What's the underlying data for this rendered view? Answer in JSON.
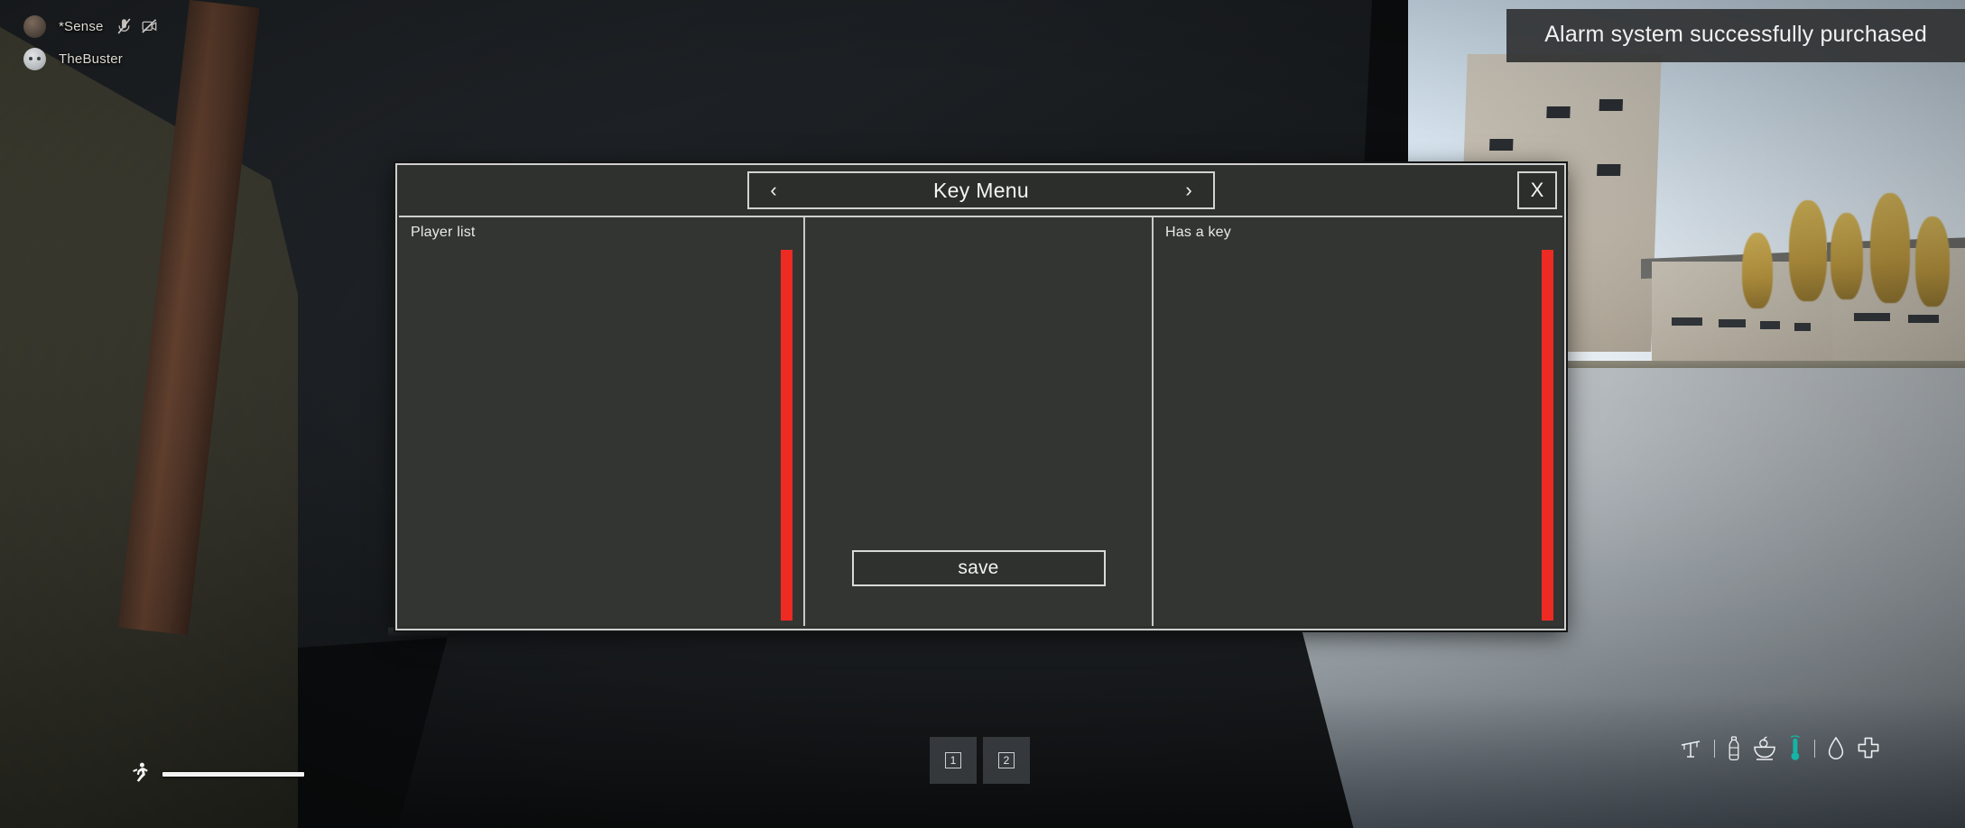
{
  "notification": {
    "icon": "none",
    "message": "Alarm system successfully purchased"
  },
  "player_hud": {
    "players": [
      {
        "name": "*Sense",
        "avatar": "player-avatar-dark",
        "status_icons": [
          "mic-muted-icon",
          "camera-muted-icon"
        ]
      },
      {
        "name": "TheBuster",
        "avatar": "player-avatar-light",
        "status_icons": []
      }
    ]
  },
  "key_menu": {
    "title": "Key Menu",
    "prev_label": "‹",
    "next_label": "›",
    "close_label": "X",
    "panels": {
      "left": {
        "title": "Player list",
        "items": [],
        "scrollbar_color": "#ee2b22"
      },
      "center": {
        "save_label": "save"
      },
      "right": {
        "title": "Has a key",
        "items": [],
        "scrollbar_color": "#ee2b22"
      }
    }
  },
  "bottom_hud": {
    "stamina": {
      "icon": "running-man-icon",
      "value": 100
    },
    "hotbar": [
      {
        "key": "1",
        "item": ""
      },
      {
        "key": "2",
        "item": ""
      }
    ],
    "status_icons": [
      {
        "name": "weight-icon",
        "state": "normal",
        "color": "#edf0f2"
      },
      {
        "name": "divider",
        "state": "static",
        "color": "#edf0f2"
      },
      {
        "name": "water-bottle-icon",
        "state": "normal",
        "color": "#edf0f2"
      },
      {
        "name": "food-bowl-icon",
        "state": "normal",
        "color": "#edf0f2"
      },
      {
        "name": "thermometer-icon",
        "state": "cold",
        "color": "#16b3a6"
      },
      {
        "name": "divider",
        "state": "static",
        "color": "#edf0f2"
      },
      {
        "name": "blood-drop-icon",
        "state": "normal",
        "color": "#edf0f2"
      },
      {
        "name": "health-cross-icon",
        "state": "normal",
        "color": "#edf0f2"
      }
    ]
  }
}
